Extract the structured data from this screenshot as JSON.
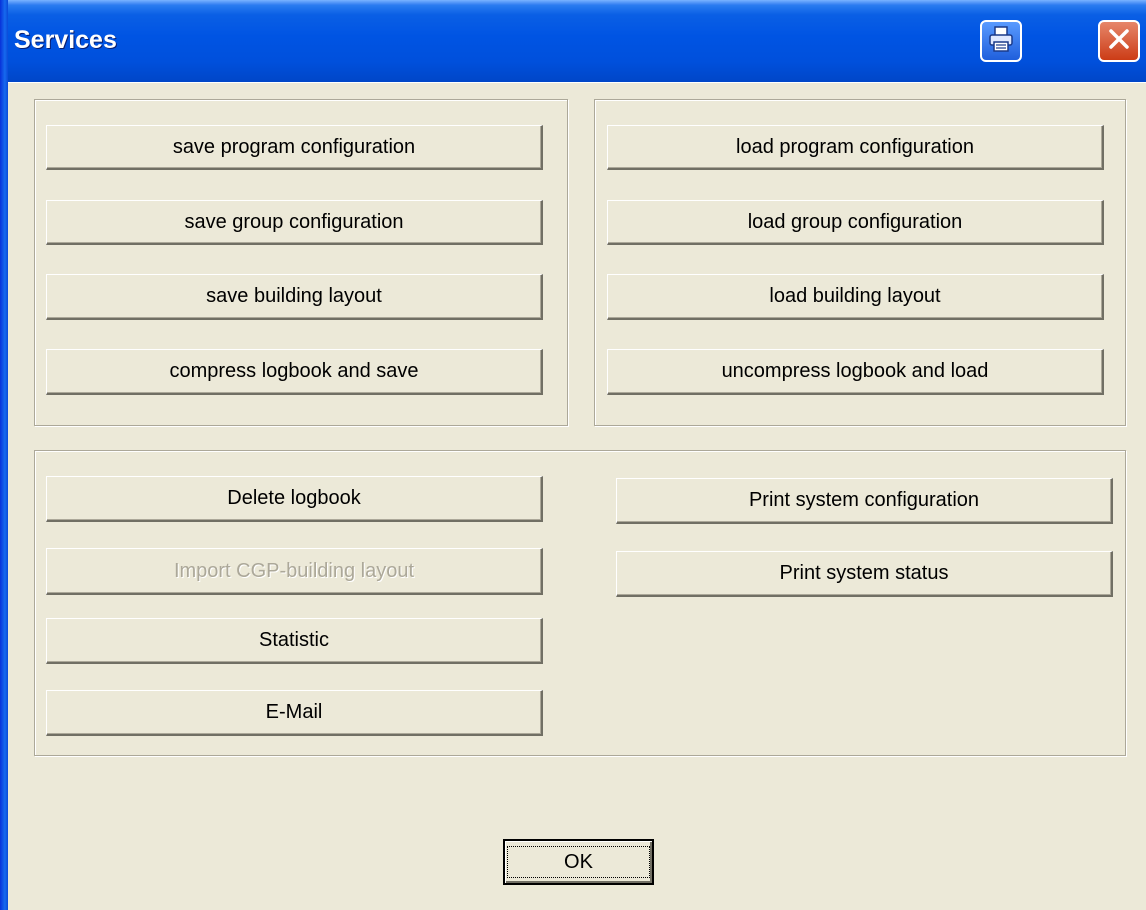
{
  "window": {
    "title": "Services",
    "titlebar_color": "#0054e3",
    "background_color": "#ece9d8"
  },
  "titlebar_buttons": {
    "print_icon": "printer-icon",
    "close_icon": "close-icon",
    "close_color": "#cc3c16"
  },
  "save_group": {
    "buttons": [
      {
        "label": "save program configuration"
      },
      {
        "label": "save group configuration"
      },
      {
        "label": "save building layout"
      },
      {
        "label": "compress logbook and save"
      }
    ]
  },
  "load_group": {
    "buttons": [
      {
        "label": "load program configuration"
      },
      {
        "label": "load group configuration"
      },
      {
        "label": "load building layout"
      },
      {
        "label": "uncompress logbook and load"
      }
    ]
  },
  "tools_group": {
    "left_buttons": [
      {
        "label": "Delete logbook",
        "enabled": true
      },
      {
        "label": "Import CGP-building layout",
        "enabled": false
      },
      {
        "label": "Statistic",
        "enabled": true
      },
      {
        "label": "E-Mail",
        "enabled": true
      }
    ],
    "right_buttons": [
      {
        "label": "Print system configuration"
      },
      {
        "label": "Print system status"
      }
    ]
  },
  "footer": {
    "ok_label": "OK"
  }
}
